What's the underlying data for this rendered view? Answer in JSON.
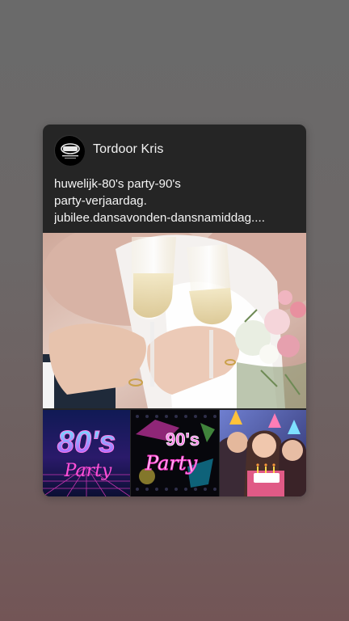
{
  "post": {
    "author": "Tordoor Kris",
    "avatar_icon": "dj-logo-icon",
    "caption_lines": [
      "huwelijk-80's party-90's",
      "party-verjaardag.",
      "jubilee.dansavonden-dansnamiddag...."
    ]
  },
  "thumbnails": {
    "eighties": {
      "top": "80's",
      "bottom": "Party"
    },
    "nineties": {
      "top": "90's",
      "bottom": "Party"
    }
  },
  "colors": {
    "card_bg": "#252525",
    "text": "#f2f2f2",
    "neon_pink": "#ff3fd0",
    "neon_cyan": "#4ff0ff"
  }
}
